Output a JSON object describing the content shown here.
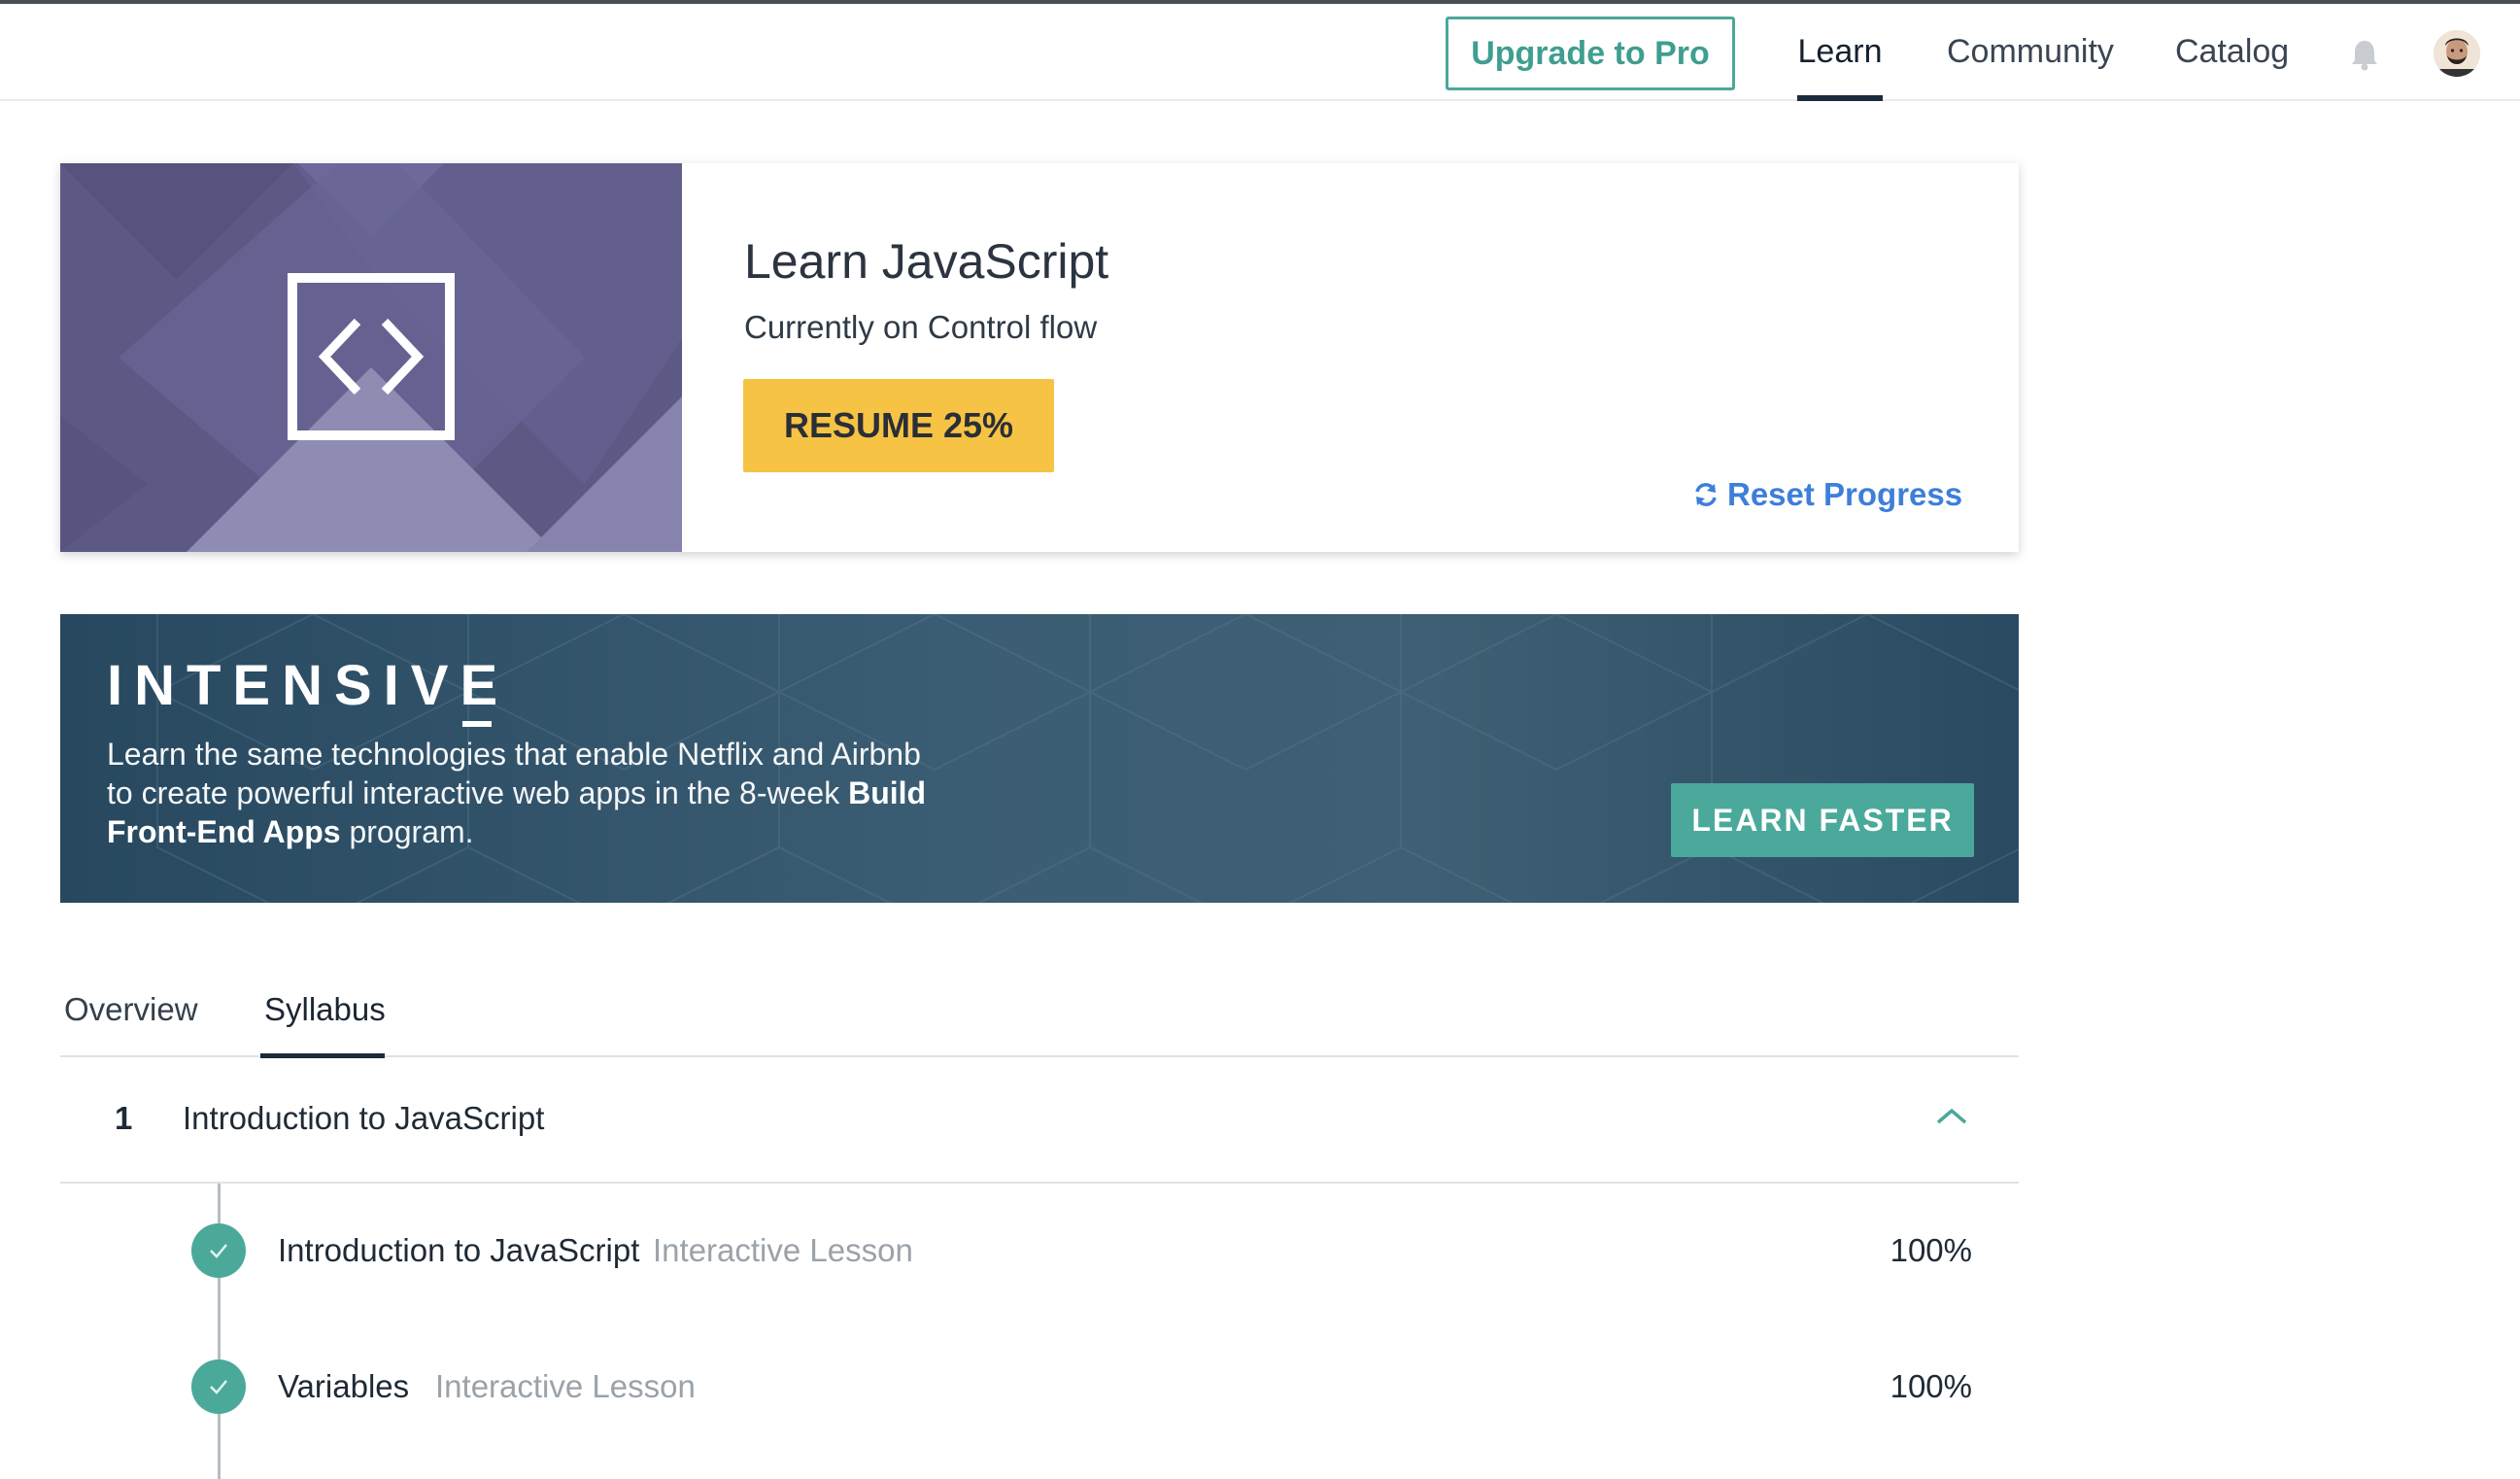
{
  "header": {
    "upgrade_label": "Upgrade to Pro",
    "nav": [
      "Learn",
      "Community",
      "Catalog"
    ],
    "active_nav": "Learn",
    "icons": [
      "bell-icon",
      "avatar"
    ]
  },
  "course": {
    "title": "Learn JavaScript",
    "subtitle": "Currently on Control flow",
    "resume_label": "RESUME 25%",
    "progress_percent": 25,
    "reset_label": "Reset Progress",
    "art_icon": "code-brackets-icon"
  },
  "intensive": {
    "logo": "INTENSIVE",
    "text_1": "Learn the same technologies that enable Netflix and Airbnb",
    "text_2": "to create powerful interactive web apps in the 8-week",
    "text_bold": "Build Front-End Apps",
    "text_3": "program.",
    "cta_label": "LEARN FASTER"
  },
  "tabs": {
    "overview": "Overview",
    "syllabus": "Syllabus",
    "active": "Syllabus"
  },
  "syllabus": {
    "module_number": "1",
    "module_title": "Introduction to JavaScript",
    "lessons": [
      {
        "title": "Introduction to JavaScript",
        "type": "Interactive Lesson",
        "percent": "100%"
      },
      {
        "title": "Variables",
        "type": "Interactive Lesson",
        "percent": "100%"
      }
    ]
  },
  "colors": {
    "accent_teal": "#4ba99a",
    "resume_yellow": "#f6c344",
    "link_blue": "#3d7fd9",
    "banner_navy": "#2e4d63"
  }
}
